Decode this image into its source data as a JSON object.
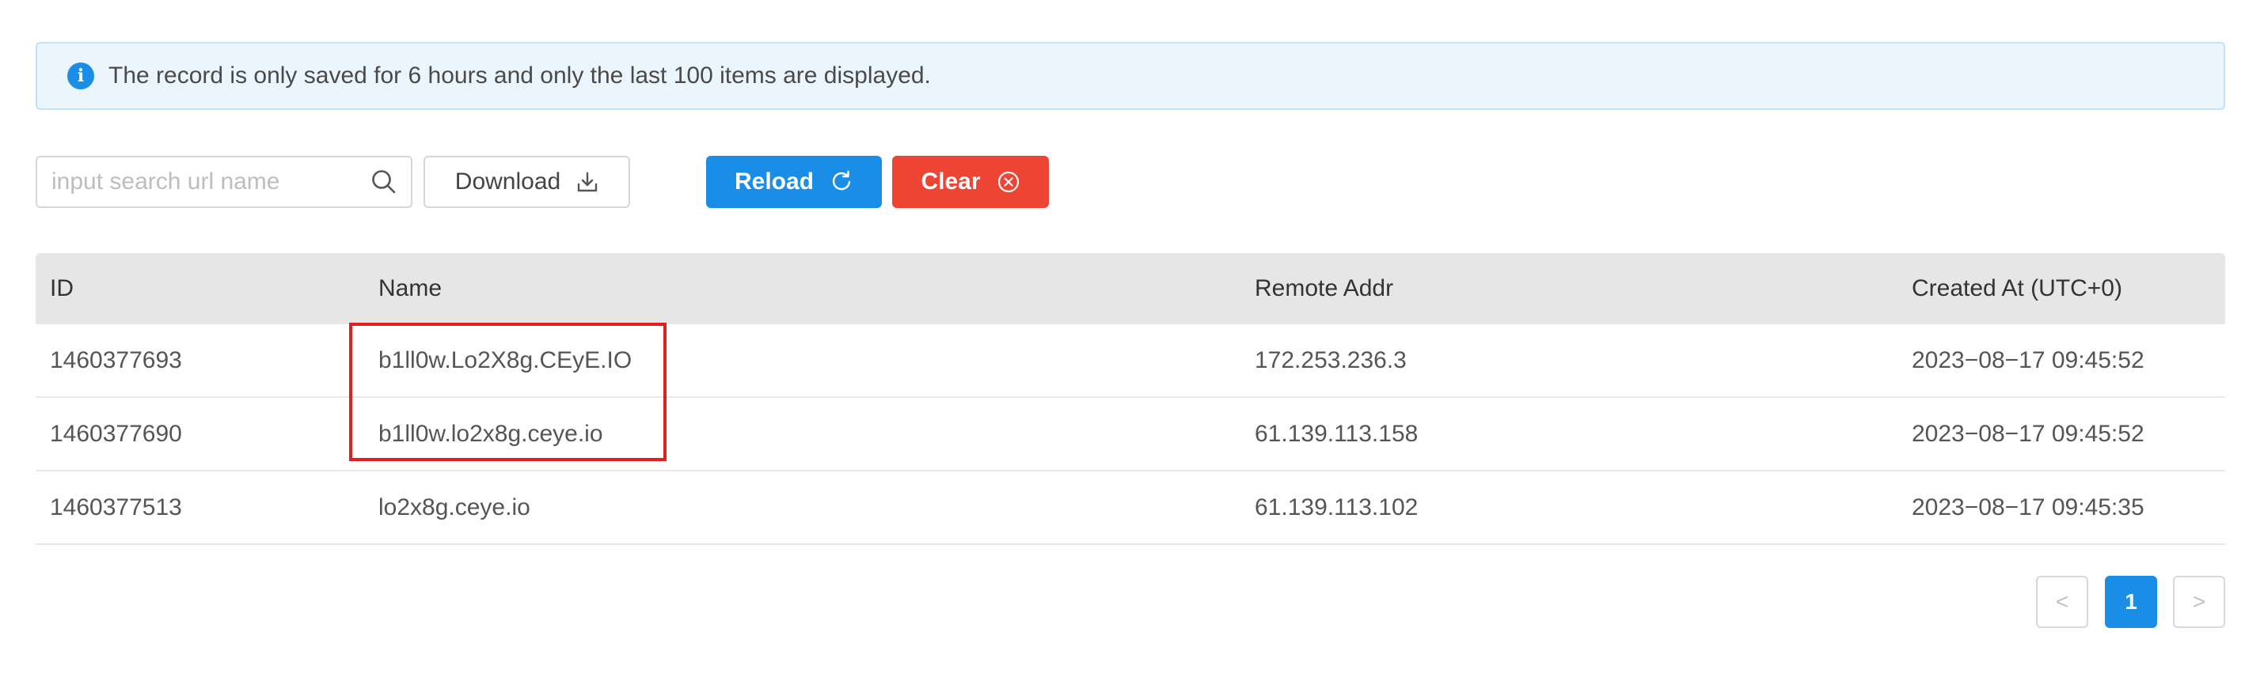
{
  "alert": {
    "icon": "info-icon",
    "icon_glyph": "i",
    "text": "The record is only saved for 6 hours and only the last 100 items are displayed."
  },
  "toolbar": {
    "search_placeholder": "input search url name",
    "search_value": "",
    "download_label": "Download",
    "reload_label": "Reload",
    "clear_label": "Clear"
  },
  "colors": {
    "primary": "#1a8ee6",
    "danger": "#ee4433",
    "highlight": "#e02020"
  },
  "table": {
    "headers": {
      "id": "ID",
      "name": "Name",
      "remote_addr": "Remote Addr",
      "created_at": "Created At (UTC+0)"
    },
    "rows": [
      {
        "id": "1460377693",
        "name": "b1ll0w.Lo2X8g.CEyE.IO",
        "remote_addr": "172.253.236.3",
        "created_at": "2023−08−17 09:45:52"
      },
      {
        "id": "1460377690",
        "name": "b1ll0w.lo2x8g.ceye.io",
        "remote_addr": "61.139.113.158",
        "created_at": "2023−08−17 09:45:52"
      },
      {
        "id": "1460377513",
        "name": "lo2x8g.ceye.io",
        "remote_addr": "61.139.113.102",
        "created_at": "2023−08−17 09:45:35"
      }
    ]
  },
  "pagination": {
    "prev": "<",
    "current_page": "1",
    "next": ">"
  }
}
